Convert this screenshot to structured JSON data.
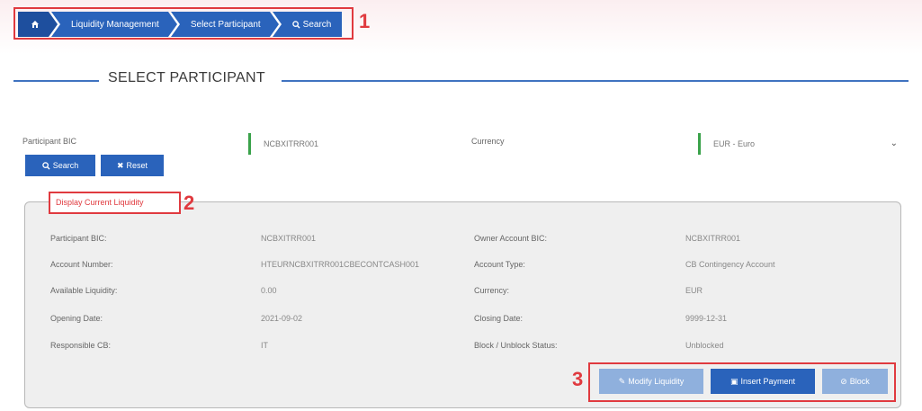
{
  "breadcrumb": {
    "home_icon": "home-icon",
    "items": [
      "Liquidity Management",
      "Select Participant",
      "Search"
    ]
  },
  "markers": [
    "1",
    "2",
    "3"
  ],
  "page_title": "SELECT PARTICIPANT",
  "form": {
    "participant_bic_label": "Participant BIC",
    "participant_bic_value": "NCBXITRR001",
    "currency_label": "Currency",
    "currency_value": "EUR - Euro"
  },
  "buttons": {
    "search": "Search",
    "reset": "Reset"
  },
  "panel": {
    "legend": "Display Current Liquidity",
    "left": [
      {
        "label": "Participant BIC:",
        "value": "NCBXITRR001"
      },
      {
        "label": "Account Number:",
        "value": "HTEURNCBXITRR001CBECONTCASH001"
      },
      {
        "label": "Available Liquidity:",
        "value": "0.00"
      },
      {
        "label": "Opening Date:",
        "value": "2021-09-02"
      },
      {
        "label": "Responsible CB:",
        "value": "IT"
      }
    ],
    "right": [
      {
        "label": "Owner Account BIC:",
        "value": "NCBXITRR001"
      },
      {
        "label": "Account Type:",
        "value": "CB Contingency Account"
      },
      {
        "label": "Currency:",
        "value": "EUR"
      },
      {
        "label": "Closing Date:",
        "value": "9999-12-31"
      },
      {
        "label": "Block / Unblock Status:",
        "value": "Unblocked"
      }
    ]
  },
  "actions": {
    "modify": "Modify Liquidity",
    "insert": "Insert Payment",
    "block": "Block"
  },
  "colors": {
    "primary": "#2a63bb",
    "primary_light": "#8fb0dd",
    "highlight": "#e03a3f",
    "field_accent": "#3aa24a"
  }
}
